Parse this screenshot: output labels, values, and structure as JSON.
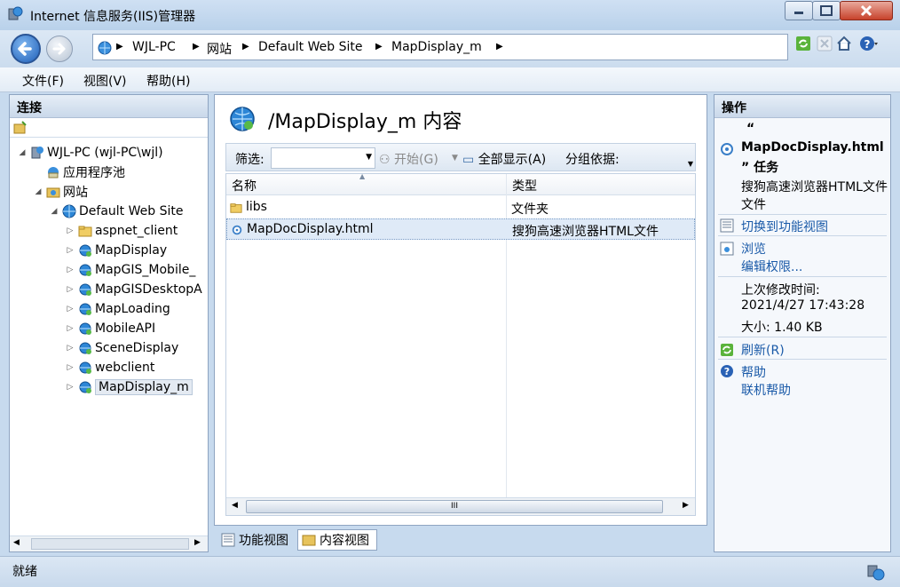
{
  "window": {
    "title": "Internet 信息服务(IIS)管理器",
    "controls": [
      "minimize-icon",
      "maximize-icon",
      "close-icon"
    ]
  },
  "address_bar": {
    "breadcrumbs": [
      "WJL-PC",
      "网站",
      "Default Web Site",
      "MapDisplay_m"
    ]
  },
  "menu": {
    "items": [
      "文件(F)",
      "视图(V)",
      "帮助(H)"
    ]
  },
  "connections": {
    "header": "连接",
    "tree": [
      {
        "label": "WJL-PC (wjl-PC\\wjl)",
        "level": 0,
        "expanded": true,
        "icon": "server-icon"
      },
      {
        "label": "应用程序池",
        "level": 1,
        "icon": "app-pool-icon"
      },
      {
        "label": "网站",
        "level": 1,
        "expanded": true,
        "icon": "sites-folder-icon"
      },
      {
        "label": "Default Web Site",
        "level": 2,
        "expanded": true,
        "icon": "globe-icon"
      },
      {
        "label": "aspnet_client",
        "level": 3,
        "icon": "folder-icon"
      },
      {
        "label": "MapDisplay",
        "level": 3,
        "icon": "web-app-icon"
      },
      {
        "label": "MapGIS_Mobile_",
        "level": 3,
        "icon": "web-app-icon"
      },
      {
        "label": "MapGISDesktopA",
        "level": 3,
        "icon": "web-app-icon"
      },
      {
        "label": "MapLoading",
        "level": 3,
        "icon": "web-app-icon"
      },
      {
        "label": "MobileAPI",
        "level": 3,
        "icon": "web-app-icon"
      },
      {
        "label": "SceneDisplay",
        "level": 3,
        "icon": "web-app-icon"
      },
      {
        "label": "webclient",
        "level": 3,
        "icon": "web-app-icon"
      },
      {
        "label": "MapDisplay_m",
        "level": 3,
        "icon": "web-app-icon",
        "selected": true
      }
    ]
  },
  "content": {
    "title": "/MapDisplay_m 内容",
    "filter": {
      "label": "筛选:",
      "start_label": "开始(G)",
      "show_all_label": "全部显示(A)",
      "group_by_label": "分组依据:"
    },
    "columns": [
      "名称",
      "类型"
    ],
    "rows": [
      {
        "name": "libs",
        "type": "文件夹",
        "icon": "folder-icon"
      },
      {
        "name": "MapDocDisplay.html",
        "type": "搜狗高速浏览器HTML文件",
        "icon": "html-file-icon",
        "selected": true
      }
    ],
    "scroll_thumb_label": "III"
  },
  "view_tabs": {
    "features": "功能视图",
    "content": "内容视图"
  },
  "actions": {
    "header": "操作",
    "task_title_quote_open": "“",
    "task_title_name": "MapDocDisplay.html",
    "task_title_quote_close": "” 任务",
    "file_type": "搜狗高速浏览器HTML文件",
    "switch_to_features": "切换到功能视图",
    "browse": "浏览",
    "edit_permissions": "编辑权限...",
    "last_modified_label": "上次修改时间:",
    "last_modified_value": "2021/4/27 17:43:28",
    "size": "大小: 1.40 KB",
    "refresh": "刷新(R)",
    "help": "帮助",
    "online_help": "联机帮助"
  },
  "status": {
    "text": "就绪"
  },
  "colors": {
    "link": "#1a5aa8",
    "panel_border": "#8ea4c1",
    "selection": "#dfeaf7"
  }
}
